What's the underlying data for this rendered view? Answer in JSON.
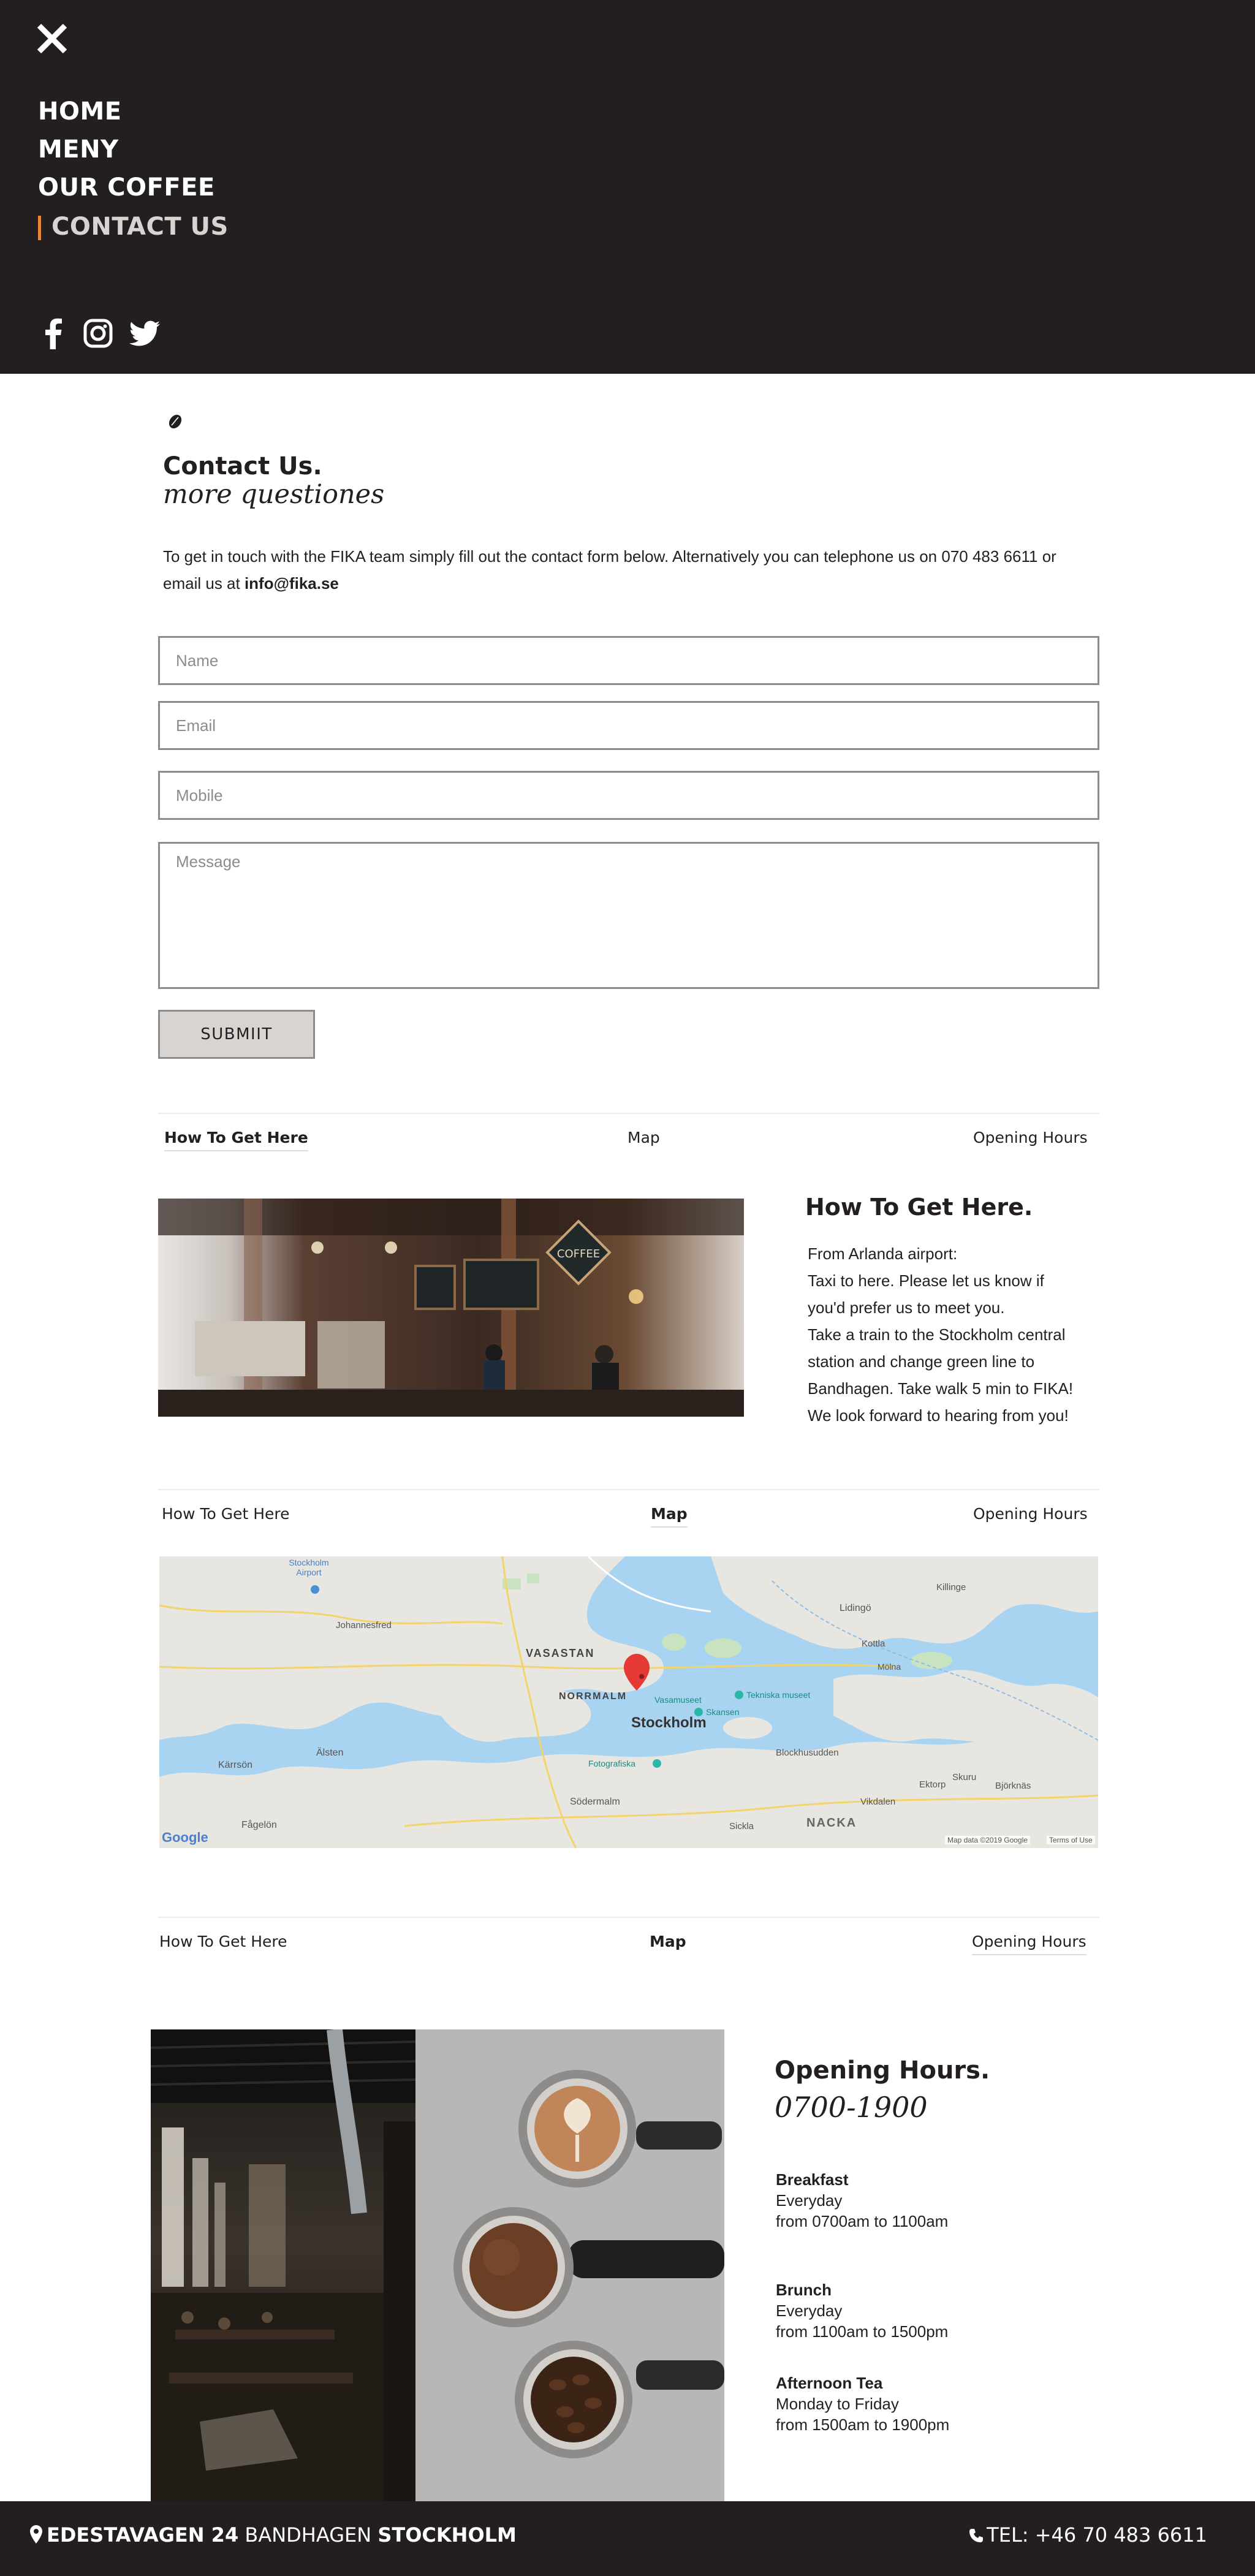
{
  "nav": {
    "close_icon": "close-icon",
    "items": [
      {
        "label": "HOME",
        "active": false
      },
      {
        "label": "MENY",
        "active": false
      },
      {
        "label": "OUR COFFEE",
        "active": false
      },
      {
        "label": "CONTACT US",
        "active": true
      }
    ],
    "social_icons": [
      "facebook-icon",
      "instagram-icon",
      "twitter-icon"
    ],
    "background_color": "#231f20",
    "accent_color": "#e8863a"
  },
  "contact": {
    "title": "Contact Us.",
    "subtitle": "more questiones",
    "intro_text": "To get in touch with the FIKA team simply fill out the contact form below. Alternatively you can telephone us on 070 483 6611 or email us at ",
    "email": "info@fika.se",
    "form": {
      "name_placeholder": "Name",
      "email_placeholder": "Email",
      "mobile_placeholder": "Mobile",
      "message_placeholder": "Message",
      "submit_label": "SUBMIIT"
    }
  },
  "tabs": {
    "how": "How To Get Here",
    "map": "Map",
    "hours": "Opening Hours"
  },
  "how_to_get_here": {
    "title": "How To Get Here.",
    "lines": [
      "From Arlanda airport:",
      "Taxi to here. Please let us know if",
      "you'd prefer us to meet you.",
      "Take a train to the Stockholm central",
      "station and change green line to",
      "Bandhagen. Take walk 5 min to FIKA!",
      "We look forward to hearing from you!"
    ],
    "photo_sign": "COFFEE"
  },
  "map": {
    "labels": {
      "city": "Stockholm",
      "norrmalm": "NORRMALM",
      "vasastan": "VASASTAN",
      "airport": "Stockholm Airport",
      "johannesfred": "Johannesfred",
      "lidingo": "Lidingö",
      "kottla": "Kottla",
      "killinge": "Killinge",
      "molna": "Mölna",
      "tekniska": "Tekniska museet",
      "vasamuseet": "Vasamuseet",
      "skansen": "Skansen",
      "blockhusudden": "Blockhusudden",
      "fotografiska": "Fotografiska",
      "sodermalm": "Södermalm",
      "alsten": "Älsten",
      "karrson": "Kärrsön",
      "fagelon": "Fågelön",
      "sickla": "Sickla",
      "nacka": "NACKA",
      "vikdalen": "Vikdalen",
      "ektorp": "Ektorp",
      "skuru": "Skuru",
      "bjorknas": "Björknäs",
      "google": "Google",
      "attribution": "Map data ©2019 Google",
      "terms": "Terms of Use"
    },
    "marker_color": "#e53935",
    "water_color": "#a8d4f2",
    "land_color": "#e8e6e1"
  },
  "opening_hours": {
    "title": "Opening Hours.",
    "time": "0700-1900",
    "meals": [
      {
        "name": "Breakfast",
        "days": "Everyday",
        "hours": "from 0700am to 1100am"
      },
      {
        "name": "Brunch",
        "days": "Everyday",
        "hours": "from 1100am to 1500pm"
      },
      {
        "name": "Afternoon Tea",
        "days": "Monday to Friday",
        "hours": "from 1500am to 1900pm"
      }
    ]
  },
  "footer": {
    "addr_street": "EDESTAVAGEN 24",
    "addr_area": " BANDHAGEN ",
    "addr_city": "STOCKHOLM",
    "tel": "TEL: +46 70 483 6611",
    "pin_icon": "map-pin-icon",
    "phone_icon": "phone-icon"
  }
}
